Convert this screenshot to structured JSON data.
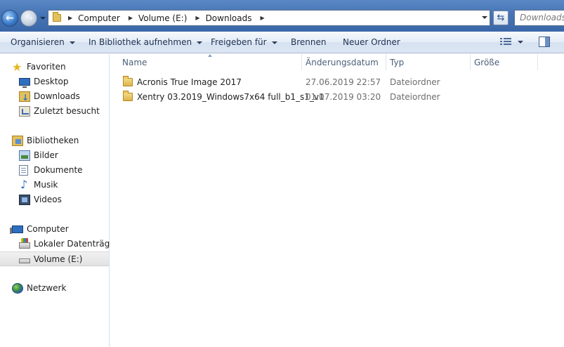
{
  "address_bar": {
    "crumbs": [
      "Computer",
      "Volume (E:)",
      "Downloads"
    ],
    "search_placeholder": "Downloads du..."
  },
  "toolbar": {
    "organize": "Organisieren",
    "include_library": "In Bibliothek aufnehmen",
    "share": "Freigeben für",
    "burn": "Brennen",
    "new_folder": "Neuer Ordner"
  },
  "nav": {
    "favorites": {
      "label": "Favoriten",
      "items": [
        {
          "label": "Desktop",
          "icon": "desktop-icon"
        },
        {
          "label": "Downloads",
          "icon": "downloads-icon"
        },
        {
          "label": "Zuletzt besucht",
          "icon": "recent-places-icon"
        }
      ]
    },
    "libraries": {
      "label": "Bibliotheken",
      "items": [
        {
          "label": "Bilder",
          "icon": "pictures-icon"
        },
        {
          "label": "Dokumente",
          "icon": "documents-icon"
        },
        {
          "label": "Musik",
          "icon": "music-icon"
        },
        {
          "label": "Videos",
          "icon": "videos-icon"
        }
      ]
    },
    "computer": {
      "label": "Computer",
      "items": [
        {
          "label": "Lokaler Datenträger",
          "icon": "local-disk-icon"
        },
        {
          "label": "Volume (E:)",
          "icon": "volume-drive-icon",
          "selected": true
        }
      ]
    },
    "network": {
      "label": "Netzwerk"
    }
  },
  "columns": {
    "name": "Name",
    "modified": "Änderungsdatum",
    "type": "Typ",
    "size": "Größe"
  },
  "files": [
    {
      "name": "Acronis True Image 2017",
      "modified": "27.06.2019 22:57",
      "type": "Dateiordner",
      "size": ""
    },
    {
      "name": "Xentry 03.2019_Windows7x64 full_b1_s1_v1",
      "modified": "01.07.2019 03:20",
      "type": "Dateiordner",
      "size": ""
    }
  ],
  "colors": {
    "title_bar": "#4675b6",
    "command_bar": "#dbe5f3",
    "selected_nav": "#e2e2e2",
    "folder": "#dcb34b"
  }
}
